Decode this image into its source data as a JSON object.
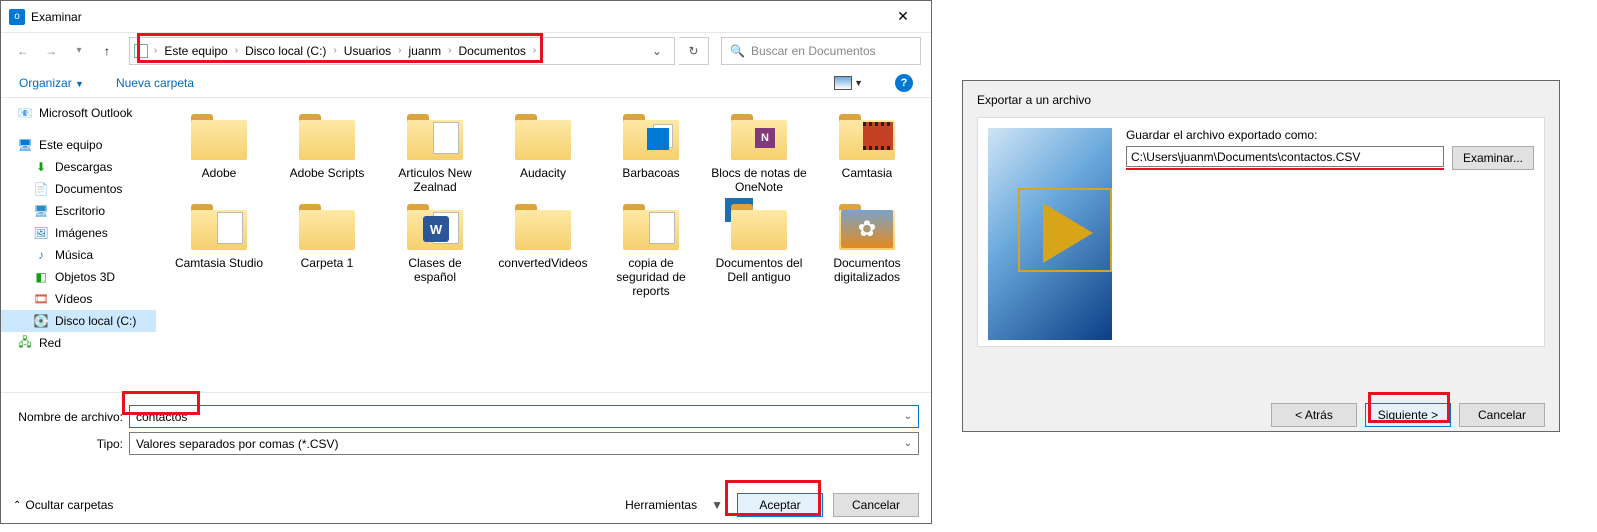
{
  "left": {
    "title": "Examinar",
    "breadcrumb": [
      "Este equipo",
      "Disco local (C:)",
      "Usuarios",
      "juanm",
      "Documentos"
    ],
    "search_placeholder": "Buscar en Documentos",
    "toolbar": {
      "organize": "Organizar",
      "new_folder": "Nueva carpeta"
    },
    "sidebar": {
      "items": [
        {
          "label": "Microsoft Outlook",
          "icon": "📧",
          "color": "#0078d4"
        },
        {
          "spacer": true
        },
        {
          "label": "Este equipo",
          "icon": "🖥",
          "color": "#0078d4"
        },
        {
          "label": "Descargas",
          "icon": "⬇",
          "color": "#12a112",
          "l2": true
        },
        {
          "label": "Documentos",
          "icon": "📄",
          "color": "#12a112",
          "l2": true
        },
        {
          "label": "Escritorio",
          "icon": "🖥",
          "color": "#2c8cc9",
          "l2": true
        },
        {
          "label": "Imágenes",
          "icon": "🖼",
          "color": "#2c8cc9",
          "l2": true
        },
        {
          "label": "Música",
          "icon": "♪",
          "color": "#2c8cc9",
          "l2": true
        },
        {
          "label": "Objetos 3D",
          "icon": "◧",
          "color": "#12a112",
          "l2": true
        },
        {
          "label": "Vídeos",
          "icon": "🎞",
          "color": "#c44125",
          "l2": true
        },
        {
          "label": "Disco local (C:)",
          "icon": "💽",
          "color": "#999",
          "l2": true,
          "sel": true
        },
        {
          "label": "Red",
          "icon": "🖧",
          "color": "#12a112"
        }
      ]
    },
    "folders": [
      {
        "label": "Adobe"
      },
      {
        "label": "Adobe Scripts"
      },
      {
        "label": "Articulos New Zealnad",
        "extra": "doc-corner"
      },
      {
        "label": "Audacity"
      },
      {
        "label": "Barbacoas",
        "extra": "clip",
        "badgeClass": "o-badge",
        "badgeText": ""
      },
      {
        "label": "Blocs de notas de OneNote",
        "badgeClass": "n-badge",
        "badgeText": "N"
      },
      {
        "label": "Camtasia",
        "extra": "film"
      },
      {
        "label": "Camtasia Studio",
        "extra": "doc-corner"
      },
      {
        "label": "Carpeta 1"
      },
      {
        "label": "Clases de español",
        "extra": "doc-corner",
        "badgeClass": "w-badge",
        "badgeText": "W"
      },
      {
        "label": "convertedVideos"
      },
      {
        "label": "copia de seguridad de reports",
        "extra": "doc-corner"
      },
      {
        "label": "Documentos del Dell antiguo",
        "extra": "bluebox"
      },
      {
        "label": "Documentos digitalizados",
        "extra": "flower"
      }
    ],
    "filename_label": "Nombre de archivo:",
    "filename_value": "contactos",
    "type_label": "Tipo:",
    "type_value": "Valores separados por comas (*.CSV)",
    "hide_folders": "Ocultar carpetas",
    "tools": "Herramientas",
    "accept": "Aceptar",
    "cancel": "Cancelar"
  },
  "right": {
    "title": "Exportar a un archivo",
    "field_label": "Guardar el archivo exportado como:",
    "path_value": "C:\\Users\\juanm\\Documents\\contactos.CSV",
    "browse": "Examinar...",
    "back": "< Atrás",
    "next": "Siguiente >",
    "cancel": "Cancelar"
  }
}
